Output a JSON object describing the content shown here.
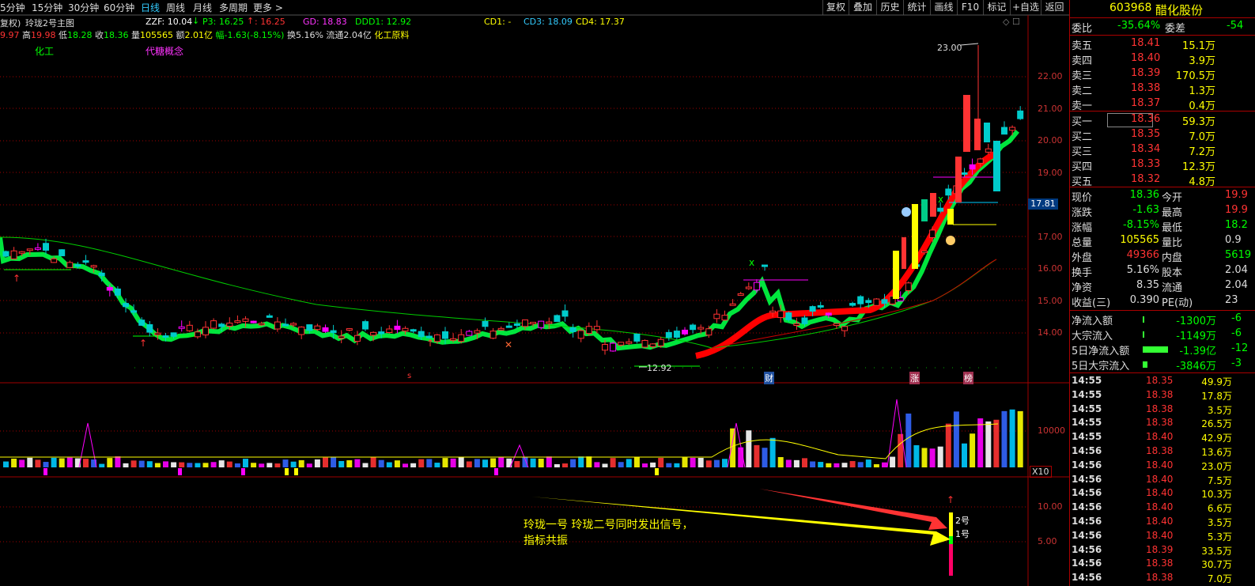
{
  "periods": [
    "5分钟",
    "15分钟",
    "30分钟",
    "60分钟",
    "日线",
    "周线",
    "月线",
    "多周期",
    "更多 >"
  ],
  "active_period": "日线",
  "toolbar": [
    "复权",
    "叠加",
    "历史",
    "统计",
    "画线",
    "F10",
    "标记",
    "+自选",
    "返回"
  ],
  "indicator_line": {
    "name_prefix": "复权)",
    "title": "玲珑2号主图",
    "zzf": "ZZF: 10.04",
    "zzf_arrow": "↓",
    "p3": "P3: 16.25",
    "p3_arrow": "↑",
    "p3b": ": 16.25",
    "gd": "GD: 18.83",
    "ddd1": "DDD1: 12.92",
    "cd1": "CD1: -",
    "cd3": "CD3: 18.09",
    "cd4": "CD4: 17.37"
  },
  "info_line": {
    "open_val": "9.97",
    "high_label": "高",
    "high_val": "19.98",
    "low_label": "低",
    "low_val": "18.28",
    "close_label": "收",
    "close_val": "18.36",
    "vol_label": "量",
    "vol_val": "105565",
    "amt_label": "额",
    "amt_val": "2.01亿",
    "chg": "幅-1.63(-8.15%)",
    "turn": "换5.16%",
    "float": "流通2.04亿",
    "sector": "化工原料"
  },
  "tags": {
    "industry": "化工",
    "concept": "代糖概念"
  },
  "price_axis": [
    "22.00",
    "21.00",
    "20.00",
    "19.00",
    "17.00",
    "16.00",
    "15.00",
    "14.00"
  ],
  "current_price_tag": "17.81",
  "peak_label": "23.00",
  "low_label": "12.92",
  "event_marks": {
    "s": "s",
    "cai": "财",
    "zhang": "涨",
    "bang": "榜"
  },
  "volume_axis": "10000",
  "volume_unit": "X10",
  "signal_axis": [
    "10.00",
    "5.00"
  ],
  "signal_labels": {
    "two": "2号",
    "one": "1号"
  },
  "annotation": "玲珑一号 玲珑二号同时发出信号，指标共振",
  "quote": {
    "code": "603968",
    "name": "醋化股份",
    "weibi_label": "委比",
    "weibi_val": "-35.64%",
    "weicha_label": "委差",
    "weicha_val": "-54",
    "asks": [
      {
        "label": "卖五",
        "price": "18.41",
        "vol": "15.1万"
      },
      {
        "label": "卖四",
        "price": "18.40",
        "vol": "3.9万"
      },
      {
        "label": "卖三",
        "price": "18.39",
        "vol": "170.5万"
      },
      {
        "label": "卖二",
        "price": "18.38",
        "vol": "1.3万"
      },
      {
        "label": "卖一",
        "price": "18.37",
        "vol": "0.4万"
      }
    ],
    "bids": [
      {
        "label": "买一",
        "price": "18.36",
        "vol": "59.3万"
      },
      {
        "label": "买二",
        "price": "18.35",
        "vol": "7.0万"
      },
      {
        "label": "买三",
        "price": "18.34",
        "vol": "7.2万"
      },
      {
        "label": "买四",
        "price": "18.33",
        "vol": "12.3万"
      },
      {
        "label": "买五",
        "price": "18.32",
        "vol": "4.8万"
      }
    ],
    "stats": [
      {
        "l1": "现价",
        "v1": "18.36",
        "l2": "今开",
        "v2": "19.9"
      },
      {
        "l1": "涨跌",
        "v1": "-1.63",
        "l2": "最高",
        "v2": "19.9"
      },
      {
        "l1": "涨幅",
        "v1": "-8.15%",
        "l2": "最低",
        "v2": "18.2"
      },
      {
        "l1": "总量",
        "v1": "105565",
        "l2": "量比",
        "v2": "0.9"
      },
      {
        "l1": "外盘",
        "v1": "49366",
        "l2": "内盘",
        "v2": "5619"
      },
      {
        "l1": "换手",
        "v1": "5.16%",
        "l2": "股本",
        "v2": "2.04"
      },
      {
        "l1": "净资",
        "v1": "8.35",
        "l2": "流通",
        "v2": "2.04"
      },
      {
        "l1": "收益(三)",
        "v1": "0.390",
        "l2": "PE(动)",
        "v2": "23"
      }
    ],
    "flows": [
      {
        "label": "净流入额",
        "val": "-1300万",
        "extra": "-6"
      },
      {
        "label": "大宗流入",
        "val": "-1149万",
        "extra": "-6"
      },
      {
        "label": "5日净流入额",
        "val": "-1.39亿",
        "extra": "-12"
      },
      {
        "label": "5日大宗流入",
        "val": "-3846万",
        "extra": "-3"
      }
    ],
    "ticks": [
      {
        "t": "14:55",
        "p": "18.35",
        "v": "49.9万"
      },
      {
        "t": "14:55",
        "p": "18.38",
        "v": "17.8万"
      },
      {
        "t": "14:55",
        "p": "18.38",
        "v": "3.5万"
      },
      {
        "t": "14:55",
        "p": "18.38",
        "v": "26.5万"
      },
      {
        "t": "14:55",
        "p": "18.40",
        "v": "42.9万"
      },
      {
        "t": "14:56",
        "p": "18.38",
        "v": "13.6万"
      },
      {
        "t": "14:56",
        "p": "18.40",
        "v": "23.0万"
      },
      {
        "t": "14:56",
        "p": "18.40",
        "v": "7.5万"
      },
      {
        "t": "14:56",
        "p": "18.40",
        "v": "10.3万"
      },
      {
        "t": "14:56",
        "p": "18.40",
        "v": "6.6万"
      },
      {
        "t": "14:56",
        "p": "18.40",
        "v": "3.5万"
      },
      {
        "t": "14:56",
        "p": "18.40",
        "v": "5.3万"
      },
      {
        "t": "14:56",
        "p": "18.39",
        "v": "33.5万"
      },
      {
        "t": "14:56",
        "p": "18.38",
        "v": "30.7万"
      },
      {
        "t": "14:56",
        "p": "18.38",
        "v": "7.0万"
      }
    ]
  },
  "colors": {
    "up": "#ff3333",
    "down": "#00d0d0",
    "ma": "#00ff40",
    "accent": "#ffd700",
    "grid": "#a00000"
  }
}
